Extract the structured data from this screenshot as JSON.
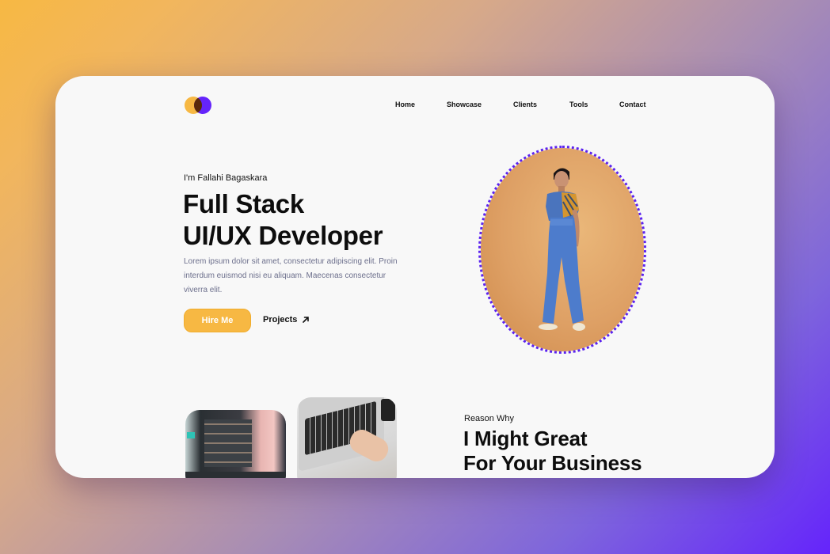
{
  "colors": {
    "accent_yellow": "#f7b843",
    "accent_purple": "#6524fb",
    "logo_overlap": "#5a2a0a",
    "text_dark": "#0d0d0d",
    "text_muted": "#6c6f8c",
    "card_bg": "#f8f8f8"
  },
  "logo": {
    "icon": "overlapping-circles-logo"
  },
  "nav": {
    "items": [
      {
        "label": "Home"
      },
      {
        "label": "Showcase"
      },
      {
        "label": "Clients"
      },
      {
        "label": "Tools"
      },
      {
        "label": "Contact"
      }
    ]
  },
  "hero": {
    "intro": "I'm Fallahi Bagaskara",
    "headline_line1": "Full Stack",
    "headline_line2": "UI/UX Developer",
    "description": "Lorem ipsum dolor sit amet, consectetur adipiscing elit. Proin interdum euismod nisi eu aliquam. Maecenas consectetur viverra elit.",
    "hire_button": "Hire Me",
    "projects_button": "Projects",
    "projects_icon": "arrow-up-right-icon",
    "portrait_alt": "Portrait of developer in blue overalls on orange background"
  },
  "reasons": {
    "label": "Reason Why",
    "title_line1": "I Might Great",
    "title_line2": "For Your Business",
    "photos": [
      {
        "alt": "Blurred code on monitor screen"
      },
      {
        "alt": "Hands typing on laptop keyboard"
      }
    ]
  }
}
